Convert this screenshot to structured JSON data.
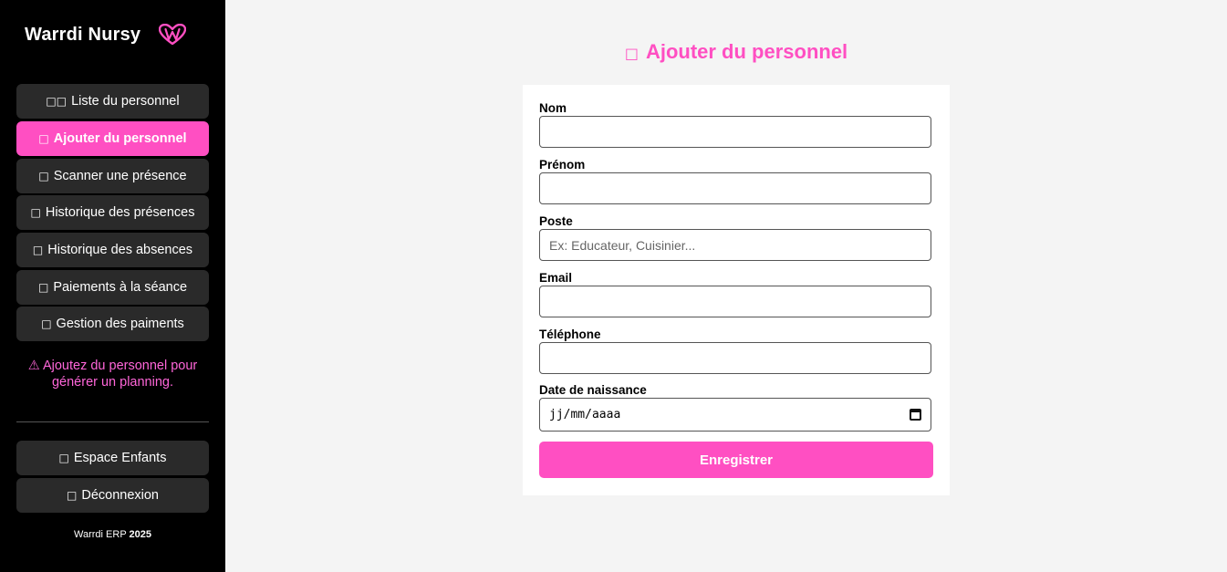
{
  "app": {
    "brand": "Warrdi Nursy",
    "logo_icon": "heart-w-logo-icon",
    "accent_color": "#ff4fc2"
  },
  "sidebar": {
    "items": [
      {
        "icon": "□□",
        "icon_name": "team-icon",
        "label": "Liste du personnel"
      },
      {
        "icon": "□",
        "icon_name": "add-person-icon",
        "label": "Ajouter du personnel",
        "active": true
      },
      {
        "icon": "□",
        "icon_name": "scan-icon",
        "label": "Scanner une présence"
      },
      {
        "icon": "□",
        "icon_name": "history-icon",
        "label": "Historique des présences"
      },
      {
        "icon": "□",
        "icon_name": "absence-icon",
        "label": "Historique des absences"
      },
      {
        "icon": "□",
        "icon_name": "payment-icon",
        "label": "Paiements à la séance"
      },
      {
        "icon": "□",
        "icon_name": "payments-management-icon",
        "label": "Gestion des paiments"
      }
    ],
    "warning": {
      "icon": "⚠",
      "text": "Ajoutez du personnel pour générer un planning."
    },
    "bottom_items": [
      {
        "icon": "□",
        "icon_name": "children-icon",
        "label": "Espace Enfants"
      },
      {
        "icon": "□",
        "icon_name": "logout-icon",
        "label": "Déconnexion"
      }
    ],
    "footer": {
      "prefix": "Warrdi ERP ",
      "year": "2025"
    }
  },
  "main": {
    "title_icon": "□",
    "title": "Ajouter du personnel",
    "form": {
      "fields": [
        {
          "label": "Nom",
          "value": "",
          "placeholder": ""
        },
        {
          "label": "Prénom",
          "value": "",
          "placeholder": ""
        },
        {
          "label": "Poste",
          "value": "",
          "placeholder": "Ex: Educateur, Cuisinier..."
        },
        {
          "label": "Email",
          "value": "",
          "placeholder": ""
        },
        {
          "label": "Téléphone",
          "value": "",
          "placeholder": ""
        }
      ],
      "date_field": {
        "label": "Date de naissance",
        "placeholder": "jj/mm/aaaa"
      },
      "submit_label": "Enregistrer"
    }
  }
}
